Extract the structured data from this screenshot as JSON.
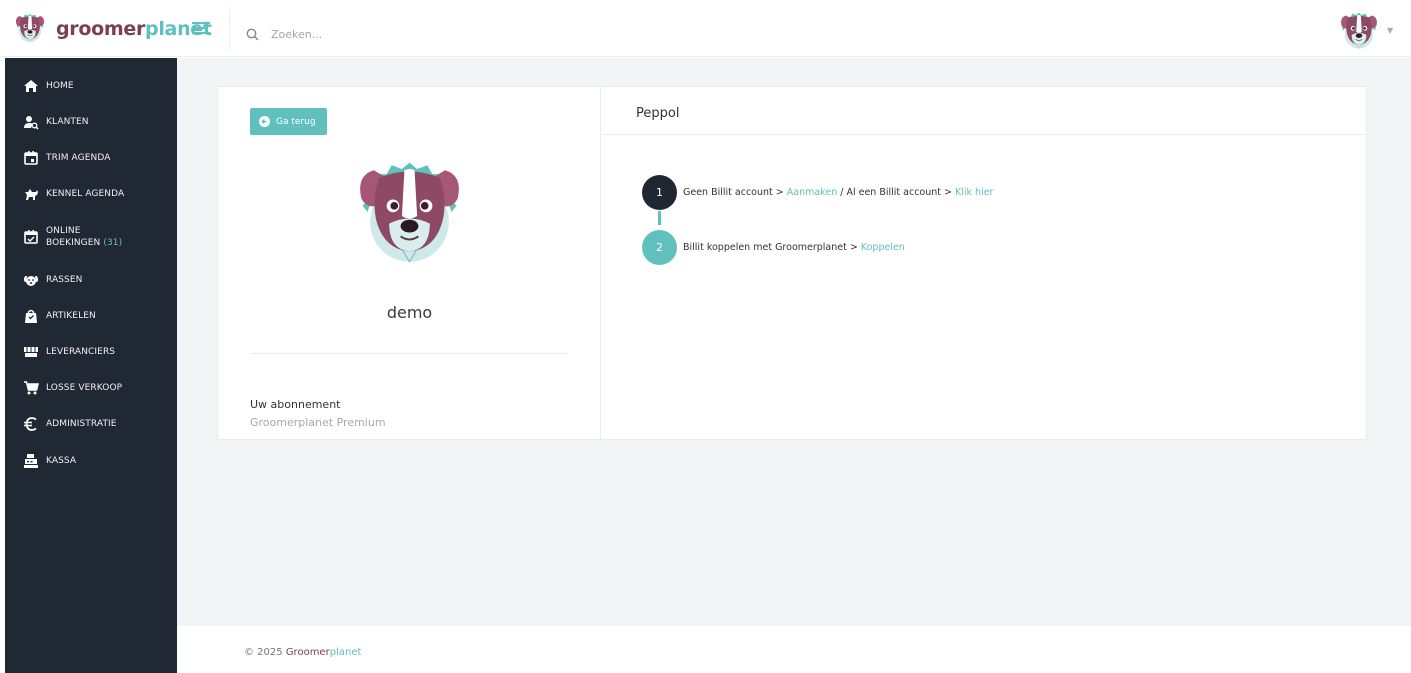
{
  "header": {
    "brand_part1": "groomer",
    "brand_part2": "planet",
    "search_placeholder": "Zoeken..."
  },
  "sidebar": {
    "items": [
      {
        "label": "HOME",
        "icon": "home-icon"
      },
      {
        "label": "KLANTEN",
        "icon": "user-search-icon"
      },
      {
        "label": "TRIM AGENDA",
        "icon": "calendar-icon"
      },
      {
        "label": "KENNEL AGENDA",
        "icon": "dog-icon"
      },
      {
        "label_line1": "ONLINE",
        "label_line2": "BOEKINGEN",
        "count": "(31)",
        "icon": "calendar-check-icon"
      },
      {
        "label": "RASSEN",
        "icon": "dog-face-icon"
      },
      {
        "label": "ARTIKELEN",
        "icon": "shopping-bag-icon"
      },
      {
        "label": "LEVERANCIERS",
        "icon": "store-icon"
      },
      {
        "label": "LOSSE VERKOOP",
        "icon": "cart-icon"
      },
      {
        "label": "ADMINISTRATIE",
        "icon": "euro-icon"
      },
      {
        "label": "KASSA",
        "icon": "cash-register-icon"
      }
    ]
  },
  "profile": {
    "back_label": "Ga terug",
    "name": "demo",
    "subscription_label": "Uw abonnement",
    "subscription_value": "Groomerplanet Premium"
  },
  "peppol": {
    "title": "Peppol",
    "step1": {
      "number": "1",
      "text_a": "Geen Billit account > ",
      "link_a": "Aanmaken",
      "text_b": " / Al een Billit account > ",
      "link_b": "Klik hier"
    },
    "step2": {
      "number": "2",
      "text_a": "Billit koppelen met Groomerplanet > ",
      "link_a": "Koppelen"
    }
  },
  "footer": {
    "prefix": "© 2025 ",
    "brand_part1": "Groomer",
    "brand_part2": "planet"
  },
  "colors": {
    "teal": "#5fc0bd",
    "brand_maroon": "#7d3e55",
    "sidebar_bg": "#202834",
    "step_dark": "#1f2733"
  }
}
